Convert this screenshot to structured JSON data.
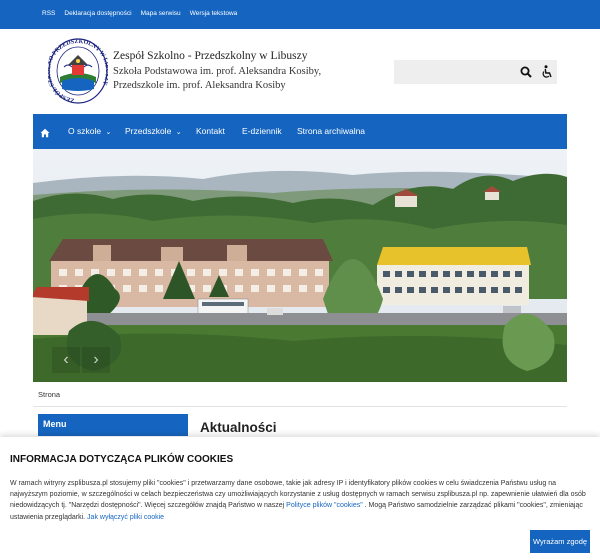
{
  "top_links": [
    "RSS",
    "Deklaracja dostępności",
    "Mapa serwisu",
    "Wersja tekstowa"
  ],
  "header": {
    "name": "Zespół Szkolno - Przedszkolny w Libuszy",
    "line1": "Szkoła Podstawowa im. prof. Aleksandra Kosiby,",
    "line2": "Przedszkole im. prof. Aleksandra Kosiby",
    "logo_ring_text": "ZESPÓŁ SZKOLNO-PRZEDSZKOLNY W LIBUSZY"
  },
  "search": {
    "placeholder": ""
  },
  "nav": {
    "home_icon": "home-icon",
    "items": [
      "O szkole",
      "Przedszkole",
      "Kontakt",
      "E-dziennik",
      "Strona archiwalna"
    ]
  },
  "breadcrumb": "Strona",
  "sidebar": {
    "menu_title": "Menu"
  },
  "main": {
    "title": "Aktualności"
  },
  "cookie": {
    "title": "INFORMACJA DOTYCZĄCA PLIKÓW COOKIES",
    "text_1": "W ramach witryny zsplibusza.pl stosujemy pliki \"cookies\" i przetwarzamy dane osobowe, takie jak adresy IP i identyfikatory plików cookies w celu świadczenia Państwu usług na najwyższym poziomie, w szczególności w celach bezpieczeństwa czy umożliwiających korzystanie z usług dostępnych w ramach serwisu zsplibusza.pl np. zapewnienie ułatwień dla osób niedowidzących tj. \"Narzędzi dostępności\". Więcej szczegółów znajdą Państwo w naszej ",
    "policy_link": "Polityce plików \"cookies\"",
    "text_2": " . Mogą Państwo samodzielnie zarządzać plikami \"cookies\", zmieniając ustawienia przeglądarki. ",
    "disable_link": "Jak wyłączyć pliki cookie",
    "accept": "Wyrażam zgodę"
  },
  "colors": {
    "primary": "#1565c0"
  }
}
